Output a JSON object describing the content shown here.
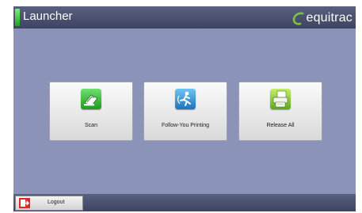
{
  "header": {
    "title": "Launcher",
    "brand": "equitrac"
  },
  "tiles": [
    {
      "label": "Scan",
      "icon": "scan-icon",
      "color": "#3bbf3b"
    },
    {
      "label": "Follow-You Printing",
      "icon": "follow-you-printing-icon",
      "color": "#2f8fd6"
    },
    {
      "label": "Release All",
      "icon": "release-all-icon",
      "color": "#8ccc2c"
    }
  ],
  "footer": {
    "logout_label": "Logout",
    "logout_icon": "logout-icon"
  },
  "colors": {
    "background": "#8c93b8",
    "bar": "#3d4360",
    "brand_accent": "#7dc242",
    "status_led": "#3fd03f"
  }
}
